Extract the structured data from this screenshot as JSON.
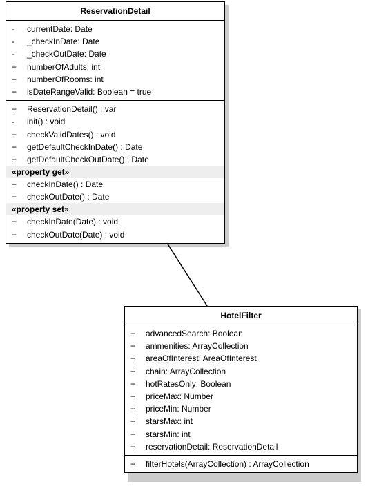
{
  "class1": {
    "name": "ReservationDetail",
    "attributes": [
      {
        "vis": "-",
        "text": "currentDate:  Date"
      },
      {
        "vis": "-",
        "text": "_checkInDate:  Date"
      },
      {
        "vis": "-",
        "text": "_checkOutDate:  Date"
      },
      {
        "vis": "+",
        "text": "numberOfAdults:  int"
      },
      {
        "vis": "+",
        "text": "numberOfRooms:  int"
      },
      {
        "vis": "+",
        "text": "isDateRangeValid:  Boolean = true"
      }
    ],
    "methods": [
      {
        "vis": "+",
        "text": "ReservationDetail() : var"
      },
      {
        "vis": "-",
        "text": "init() : void"
      },
      {
        "vis": "+",
        "text": "checkValidDates() : void"
      },
      {
        "vis": "+",
        "text": "getDefaultCheckInDate() : Date"
      },
      {
        "vis": "+",
        "text": "getDefaultCheckOutDate() : Date"
      }
    ],
    "prop_get_label": "«property get»",
    "prop_get": [
      {
        "vis": "+",
        "text": "checkInDate() : Date"
      },
      {
        "vis": "+",
        "text": "checkOutDate() : Date"
      }
    ],
    "prop_set_label": "«property set»",
    "prop_set": [
      {
        "vis": "+",
        "text": "checkInDate(Date) : void"
      },
      {
        "vis": "+",
        "text": "checkOutDate(Date) : void"
      }
    ]
  },
  "class2": {
    "name": "HotelFilter",
    "attributes": [
      {
        "vis": "+",
        "text": "advancedSearch:  Boolean"
      },
      {
        "vis": "+",
        "text": "ammenities:  ArrayCollection"
      },
      {
        "vis": "+",
        "text": "areaOfInterest:  AreaOfInterest"
      },
      {
        "vis": "+",
        "text": "chain:  ArrayCollection"
      },
      {
        "vis": "+",
        "text": "hotRatesOnly:  Boolean"
      },
      {
        "vis": "+",
        "text": "priceMax:  Number"
      },
      {
        "vis": "+",
        "text": "priceMin:  Number"
      },
      {
        "vis": "+",
        "text": "starsMax:  int"
      },
      {
        "vis": "+",
        "text": "starsMin:  int"
      },
      {
        "vis": "+",
        "text": "reservationDetail:  ReservationDetail"
      }
    ],
    "methods": [
      {
        "vis": "+",
        "text": "filterHotels(ArrayCollection) : ArrayCollection"
      }
    ]
  }
}
